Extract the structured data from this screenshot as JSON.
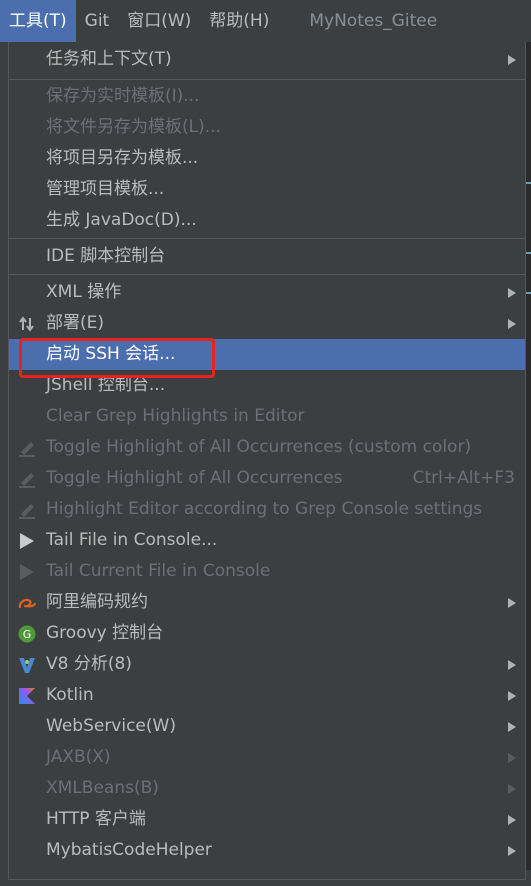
{
  "menubar": {
    "items": [
      "工具(T)",
      "Git",
      "窗口(W)",
      "帮助(H)"
    ],
    "project_title": "MyNotes_Gitee"
  },
  "menu": {
    "items": [
      {
        "label": "任务和上下文(T)"
      },
      {
        "label": "保存为实时模板(I)..."
      },
      {
        "label": "将文件另存为模板(L)..."
      },
      {
        "label": "将项目另存为模板..."
      },
      {
        "label": "管理项目模板..."
      },
      {
        "label": "生成 JavaDoc(D)..."
      },
      {
        "label": "IDE 脚本控制台"
      },
      {
        "label": "XML 操作"
      },
      {
        "label": "部署(E)",
        "icon": "deploy-arrows-icon"
      },
      {
        "label": "启动 SSH 会话..."
      },
      {
        "label": "JShell 控制台..."
      },
      {
        "label": "Clear Grep Highlights in Editor"
      },
      {
        "label": "Toggle Highlight of All Occurrences (custom color)",
        "icon": "highlighter-icon"
      },
      {
        "label": "Toggle Highlight of All Occurrences",
        "shortcut": "Ctrl+Alt+F3",
        "icon": "highlighter-icon"
      },
      {
        "label": "Highlight Editor according to Grep Console settings",
        "icon": "highlighter-icon"
      },
      {
        "label": "Tail File in Console...",
        "icon": "play-icon"
      },
      {
        "label": "Tail Current File in Console",
        "icon": "play-icon"
      },
      {
        "label": "阿里编码规约",
        "icon": "alibaba-logo-icon"
      },
      {
        "label": "Groovy 控制台",
        "icon": "groovy-icon"
      },
      {
        "label": "V8 分析(8)",
        "icon": "v8-icon"
      },
      {
        "label": "Kotlin",
        "icon": "kotlin-icon"
      },
      {
        "label": "WebService(W)"
      },
      {
        "label": "JAXB(X)"
      },
      {
        "label": "XMLBeans(B)"
      },
      {
        "label": "HTTP 客户端"
      },
      {
        "label": "MybatisCodeHelper"
      }
    ]
  },
  "colors": {
    "background": "#3c3f41",
    "selection": "#4b6eaf",
    "text": "#bbbbbb",
    "disabled_text": "#6c7074",
    "annotation_box": "#e8231f"
  }
}
